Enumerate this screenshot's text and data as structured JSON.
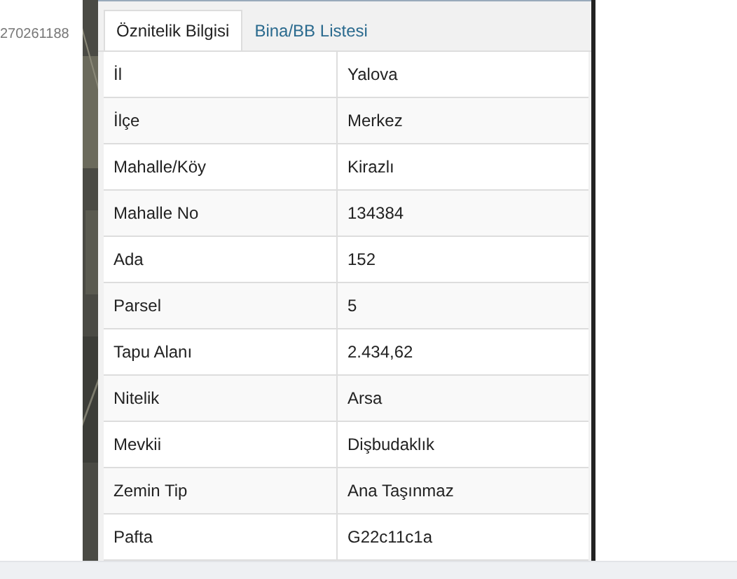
{
  "side_label": "270261188",
  "tabs": [
    {
      "label": "Öznitelik Bilgisi",
      "selected": true
    },
    {
      "label": "Bina/BB Listesi",
      "selected": false
    }
  ],
  "rows": [
    {
      "label": "İl",
      "value": "Yalova"
    },
    {
      "label": "İlçe",
      "value": "Merkez"
    },
    {
      "label": "Mahalle/Köy",
      "value": "Kirazlı"
    },
    {
      "label": "Mahalle No",
      "value": "134384"
    },
    {
      "label": "Ada",
      "value": "152"
    },
    {
      "label": "Parsel",
      "value": "5"
    },
    {
      "label": "Tapu Alanı",
      "value": "2.434,62"
    },
    {
      "label": "Nitelik",
      "value": "Arsa"
    },
    {
      "label": "Mevkii",
      "value": "Dişbudaklık"
    },
    {
      "label": "Zemin Tip",
      "value": "Ana Taşınmaz"
    },
    {
      "label": "Pafta",
      "value": "G22c11c1a"
    }
  ]
}
